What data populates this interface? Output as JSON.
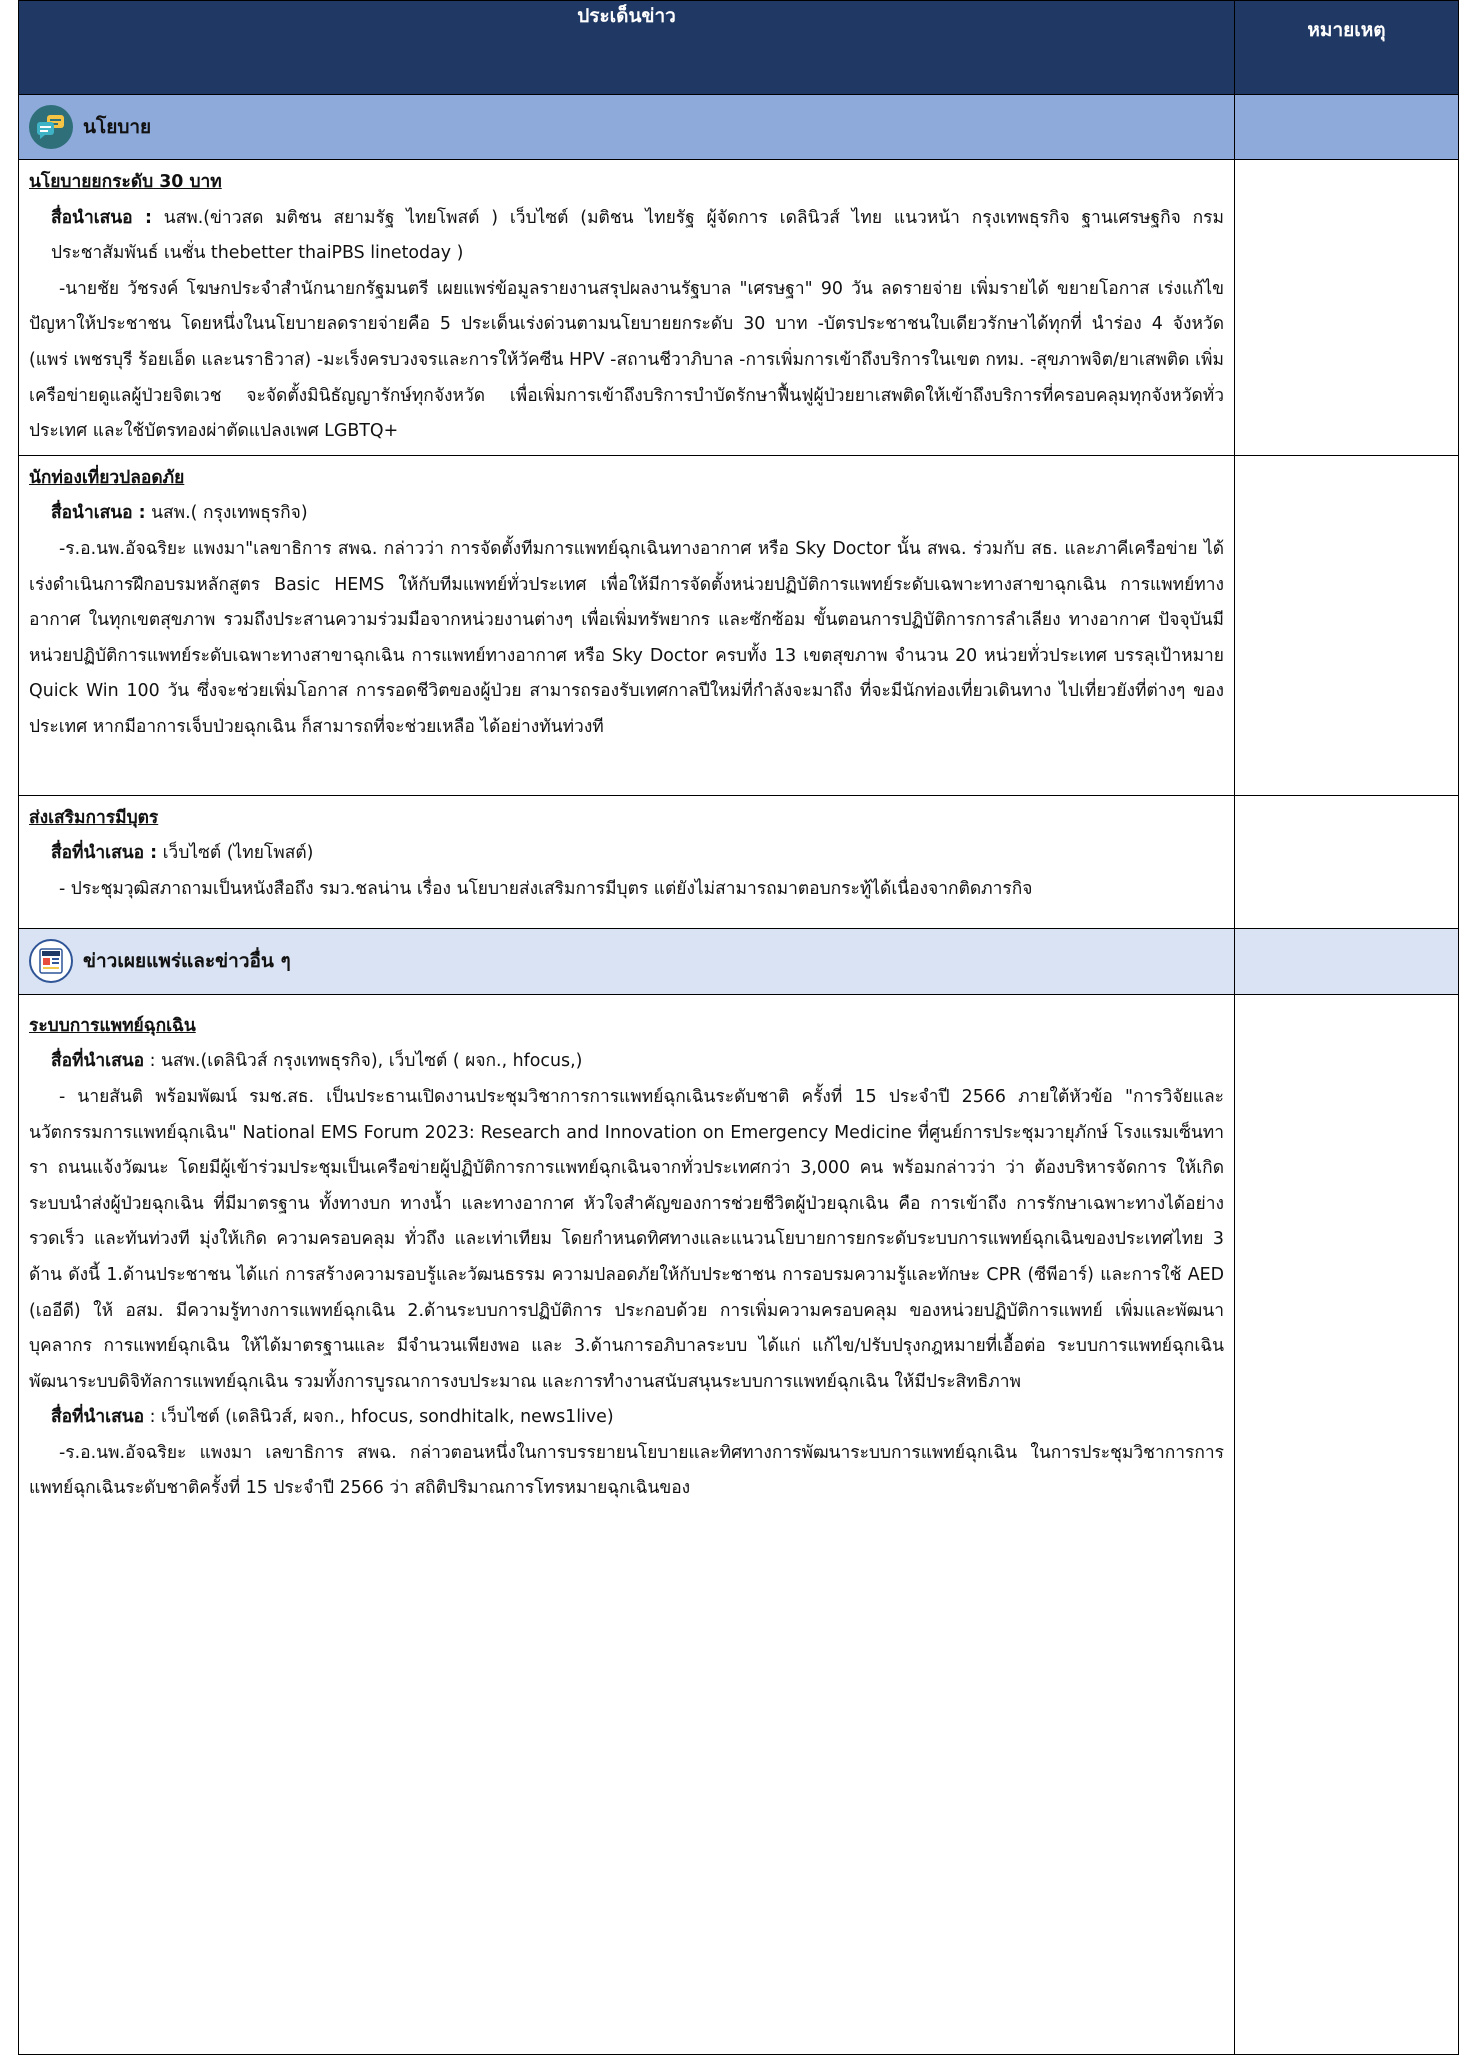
{
  "header": {
    "main_title": "ประเด็นข่าว",
    "note_title": "หมายเหตุ"
  },
  "sections": [
    {
      "title": "นโยบาย",
      "icon": "chat-bubbles-icon"
    },
    {
      "title": "ข่าวเผยแพร่และข่าวอื่น ๆ",
      "icon": "newspaper-icon"
    }
  ],
  "topics": [
    {
      "title": "นโยบายยกระดับ 30 บาท",
      "source_label": "สื่อนำเสนอ :",
      "source_text": "นสพ.(ข่าวสด มติชน สยามรัฐ ไทยโพสต์ ) เว็บไซต์ (มติชน ไทยรัฐ ผู้จัดการ เดลินิวส์ ไทย แนวหน้า กรุงเทพธุรกิจ ฐานเศรษฐกิจ กรมประชาสัมพันธ์ เนชั่น thebetter thaiPBS linetoday )",
      "body": "-นายชัย วัชรงค์ โฆษกประจำสำนักนายกรัฐมนตรี เผยแพร่ข้อมูลรายงานสรุปผลงานรัฐบาล \"เศรษฐา\" 90 วัน ลดรายจ่าย เพิ่มรายได้ ขยายโอกาส เร่งแก้ไขปัญหาให้ประชาชน โดยหนึ่งในนโยบายลดรายจ่ายคือ 5 ประเด็นเร่งด่วนตามนโยบายยกระดับ 30 บาท -บัตรประชาชนใบเดียวรักษาได้ทุกที่ นำร่อง 4 จังหวัด (แพร่ เพชรบุรี ร้อยเอ็ด และนราธิวาส) -มะเร็งครบวงจรและการให้วัคซีน HPV -สถานชีวาภิบาล -การเพิ่มการเข้าถึงบริการในเขต กทม. -สุขภาพจิต/ยาเสพติด เพิ่มเครือข่ายดูแลผู้ป่วยจิตเวช จะจัดตั้งมินิธัญญารักษ์ทุกจังหวัด เพื่อเพิ่มการเข้าถึงบริการบำบัดรักษาฟื้นฟูผู้ป่วยยาเสพติดให้เข้าถึงบริการที่ครอบคลุมทุกจังหวัดทั่วประเทศ และใช้บัตรทองผ่าตัดแปลงเพศ LGBTQ+"
    },
    {
      "title": "นักท่องเที่ยวปลอดภัย",
      "source_label": "สื่อนำเสนอ :",
      "source_text": "นสพ.( กรุงเทพธุรกิจ)",
      "body": "-ร.อ.นพ.อัจฉริยะ แพงมา\"เลขาธิการ สพฉ. กล่าวว่า การจัดตั้งทีมการแพทย์ฉุกเฉินทางอากาศ หรือ Sky Doctor นั้น สพฉ. ร่วมกับ สธ. และภาคีเครือข่าย ได้เร่งดำเนินการฝึกอบรมหลักสูตร Basic HEMS ให้กับทีมแพทย์ทั่วประเทศ เพื่อให้มีการจัดตั้งหน่วยปฏิบัติการแพทย์ระดับเฉพาะทางสาขาฉุกเฉิน การแพทย์ทางอากาศ ในทุกเขตสุขภาพ รวมถึงประสานความร่วมมือจากหน่วยงานต่างๆ เพื่อเพิ่มทรัพยากร และซักซ้อม ขั้นตอนการปฏิบัติการการลำเลียง ทางอากาศ ปัจจุบันมีหน่วยปฏิบัติการแพทย์ระดับเฉพาะทางสาขาฉุกเฉิน การแพทย์ทางอากาศ หรือ Sky Doctor ครบทั้ง 13 เขตสุขภาพ จำนวน 20 หน่วยทั่วประเทศ บรรลุเป้าหมาย Quick Win 100 วัน ซึ่งจะช่วยเพิ่มโอกาส การรอดชีวิตของผู้ป่วย สามารถรองรับเทศกาลปีใหม่ที่กำลังจะมาถึง ที่จะมีนักท่องเที่ยวเดินทาง ไปเที่ยวยังที่ต่างๆ ของประเทศ หากมีอาการเจ็บป่วยฉุกเฉิน ก็สามารถที่จะช่วยเหลือ ได้อย่างทันท่วงที"
    },
    {
      "title": "ส่งเสริมการมีบุตร",
      "source_label": "สื่อที่นำเสนอ :",
      "source_text": "เว็บไซต์ (ไทยโพสต์)",
      "body": "- ประชุมวุฒิสภาถามเป็นหนังสือถึง รมว.ชลน่าน เรื่อง นโยบายส่งเสริมการมีบุตร แต่ยังไม่สามารถมาตอบกระทู้ได้เนื่องจากติดภารกิจ"
    },
    {
      "title": "ระบบการแพทย์ฉุกเฉิน",
      "source_label": "สื่อที่นำเสนอ",
      "source_text": ": นสพ.(เดลินิวส์ กรุงเทพธุรกิจ), เว็บไซต์ ( ผจก., hfocus,)",
      "body": "- นายสันติ พร้อมพัฒน์ รมช.สธ. เป็นประธานเปิดงานประชุมวิชาการการแพทย์ฉุกเฉินระดับชาติ ครั้งที่ 15 ประจำปี 2566 ภายใต้หัวข้อ \"การวิจัยและนวัตกรรมการแพทย์ฉุกเฉิน\" National EMS Forum 2023: Research and Innovation on Emergency Medicine ที่ศูนย์การประชุมวายุภักษ์ โรงแรมเซ็นทารา ถนนแจ้งวัฒนะ โดยมีผู้เข้าร่วมประชุมเป็นเครือข่ายผู้ปฏิบัติการการแพทย์ฉุกเฉินจากทั่วประเทศกว่า 3,000 คน พร้อมกล่าวว่า ว่า ต้องบริหารจัดการ ให้เกิดระบบนำส่งผู้ป่วยฉุกเฉิน ที่มีมาตรฐาน ทั้งทางบก ทางน้ำ และทางอากาศ หัวใจสำคัญของการช่วยชีวิตผู้ป่วยฉุกเฉิน คือ การเข้าถึง การรักษาเฉพาะทางได้อย่างรวดเร็ว และทันท่วงที มุ่งให้เกิด ความครอบคลุม ทั่วถึง และเท่าเทียม โดยกำหนดทิศทางและแนวนโยบายการยกระดับระบบการแพทย์ฉุกเฉินของประเทศไทย 3 ด้าน ดังนี้ 1.ด้านประชาชน ได้แก่ การสร้างความรอบรู้และวัฒนธรรม ความปลอดภัยให้กับประชาชน การอบรมความรู้และทักษะ CPR (ซีพีอาร์) และการใช้ AED (เออีดี) ให้ อสม. มีความรู้ทางการแพทย์ฉุกเฉิน 2.ด้านระบบการปฏิบัติการ ประกอบด้วย การเพิ่มความครอบคลุม ของหน่วยปฏิบัติการแพทย์ เพิ่มและพัฒนาบุคลากร การแพทย์ฉุกเฉิน ให้ได้มาตรฐานและ มีจำนวนเพียงพอ และ 3.ด้านการอภิบาลระบบ ได้แก่ แก้ไข/ปรับปรุงกฎหมายที่เอื้อต่อ ระบบการแพทย์ฉุกเฉิน พัฒนาระบบดิจิทัลการแพทย์ฉุกเฉิน รวมทั้งการบูรณาการงบประมาณ และการทำงานสนับสนุนระบบการแพทย์ฉุกเฉิน ให้มีประสิทธิภาพ",
      "source2_label": "สื่อที่นำเสนอ",
      "source2_text": ": เว็บไซต์ (เดลินิวส์, ผจก., hfocus, sondhitalk, news1live)",
      "body2": "-ร.อ.นพ.อัจฉริยะ แพงมา เลขาธิการ สพฉ. กล่าวตอนหนึ่งในการบรรยายนโยบายและทิศทางการพัฒนาระบบการแพทย์ฉุกเฉิน ในการประชุมวิชาการการแพทย์ฉุกเฉินระดับชาติครั้งที่ 15 ประจำปี 2566 ว่า สถิติปริมาณการโทรหมายฉุกเฉินของ"
    }
  ],
  "colors": {
    "header_bg": "#1f3864",
    "section_bg": "#8eaadb",
    "section2_bg": "#dae3f3"
  }
}
